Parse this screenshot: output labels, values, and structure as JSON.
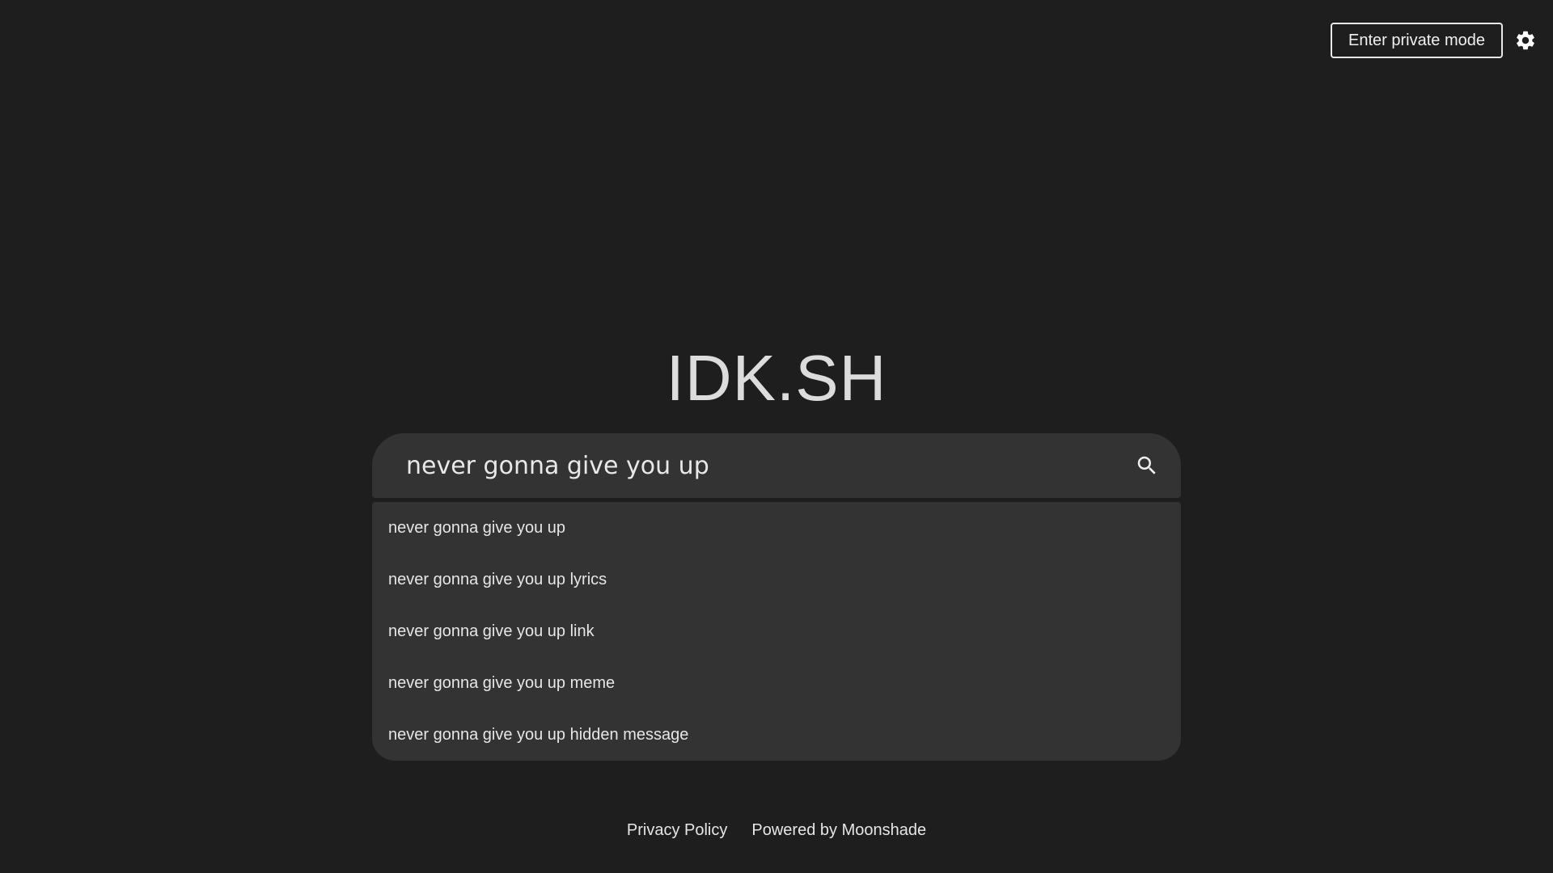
{
  "header": {
    "private_mode_label": "Enter private mode",
    "settings_icon": "gear-icon"
  },
  "logo": {
    "text": "IDK.SH"
  },
  "search": {
    "value": "never gonna give you up",
    "placeholder": "",
    "search_icon": "search-icon"
  },
  "suggestions": [
    "never gonna give you up",
    "never gonna give you up lyrics",
    "never gonna give you up link",
    "never gonna give you up meme",
    "never gonna give you up hidden message"
  ],
  "footer": {
    "privacy_label": "Privacy Policy",
    "powered_label": "Powered by Moonshade"
  },
  "colors": {
    "background": "#1e1e1e",
    "surface": "#333333",
    "text": "#e6e6e6"
  }
}
